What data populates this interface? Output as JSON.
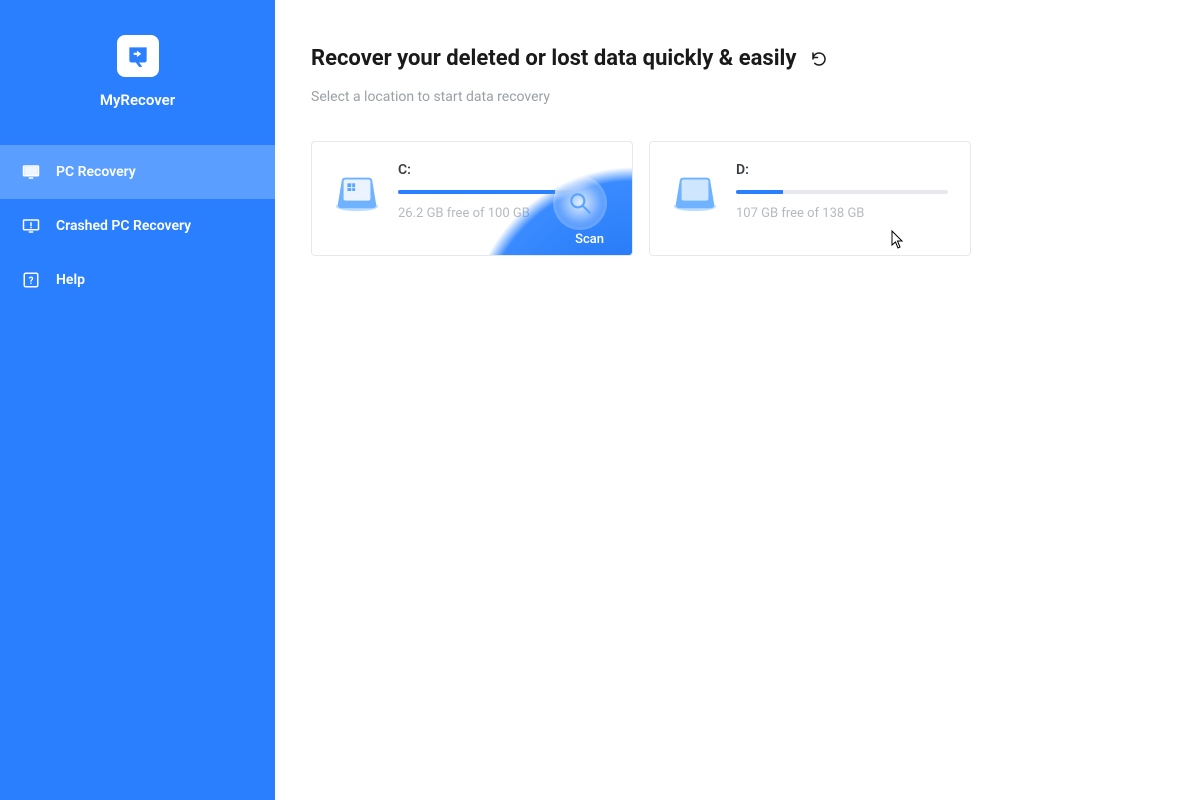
{
  "brand": {
    "name": "MyRecover"
  },
  "sidebar": {
    "items": [
      {
        "label": "PC Recovery",
        "icon": "monitor"
      },
      {
        "label": "Crashed PC Recovery",
        "icon": "monitor-alert"
      },
      {
        "label": "Help",
        "icon": "help"
      }
    ]
  },
  "header": {
    "title": "Recover your deleted or lost data quickly & easily",
    "subtitle": "Select a location to start data recovery"
  },
  "scan": {
    "label": "Scan"
  },
  "drives": [
    {
      "label": "C:",
      "free_text": "26.2 GB free of 100 GB",
      "used_pct": 74,
      "type": "system",
      "hovered": true
    },
    {
      "label": "D:",
      "free_text": "107 GB free of 138 GB",
      "used_pct": 22,
      "type": "data",
      "hovered": false
    }
  ]
}
